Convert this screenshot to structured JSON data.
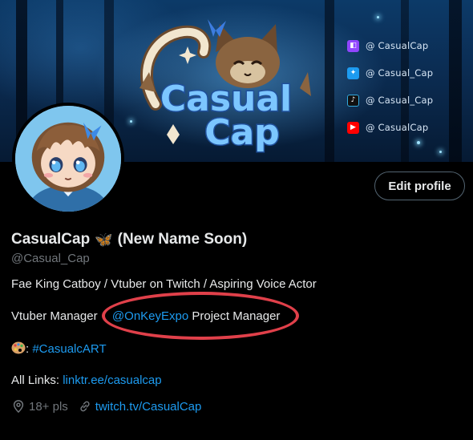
{
  "banner": {
    "logo_text_line1": "Casual",
    "logo_text_line2": "Cap",
    "socials": [
      {
        "icon": "twitch-icon",
        "handle": "@ CasualCap"
      },
      {
        "icon": "twitter-icon",
        "handle": "@ Casual_Cap"
      },
      {
        "icon": "tiktok-icon",
        "handle": "@ Casual_Cap"
      },
      {
        "icon": "youtube-icon",
        "handle": "@ CasualCap"
      }
    ]
  },
  "actions": {
    "edit_profile": "Edit profile"
  },
  "profile": {
    "name_prefix": "CasualCap",
    "name_emoji": "🦋",
    "name_suffix": "(New Name Soon)",
    "handle": "@Casual_Cap",
    "bio_line1": "Fae King Catboy / Vtuber on Twitch / Aspiring Voice Actor",
    "bio_line2_prefix": "Vtuber Manager",
    "bio_line2_mention": "@OnKeyExpo",
    "bio_line2_suffix": "Project Manager",
    "bio_line3_prefix": ":",
    "bio_line3_hashtag": "#CasualcART",
    "bio_line4_prefix": "All Links:",
    "bio_line4_link": "linktr.ee/casualcap",
    "location": "18+ pls",
    "website": "twitch.tv/CasualCap"
  },
  "colors": {
    "accent": "#1d9bf0",
    "annotation": "#e0404a",
    "muted": "#71767b"
  }
}
